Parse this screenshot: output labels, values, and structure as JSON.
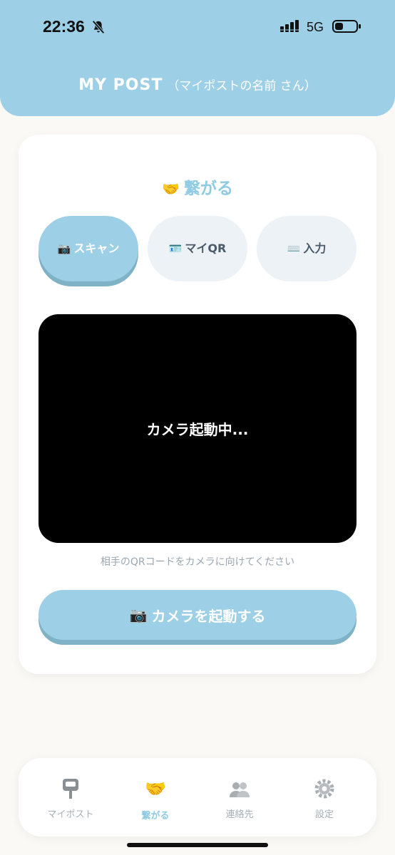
{
  "status_bar": {
    "time": "22:36",
    "network": "5G",
    "icons": [
      "bell-slash-icon",
      "signal-icon",
      "battery-icon"
    ]
  },
  "header": {
    "brand": "MY POST",
    "user": "（マイポストの名前 さん）",
    "color": "#9dcfe6"
  },
  "section": {
    "emoji": "🤝",
    "title": "繋がる"
  },
  "tabs": [
    {
      "emoji": "📷",
      "label": "スキャン",
      "active": true
    },
    {
      "emoji": "🪪",
      "label": "マイQR",
      "active": false
    },
    {
      "emoji": "⌨️",
      "label": "入力",
      "active": false
    }
  ],
  "camera": {
    "status": "カメラ起動中...",
    "hint": "相手のQRコードをカメラに向けてください"
  },
  "start_button": {
    "emoji": "📷",
    "label": "カメラを起動する"
  },
  "bottom_nav": {
    "items": [
      {
        "label": "マイポスト",
        "icon": "mailbox-icon",
        "active": false
      },
      {
        "label": "繋がる",
        "icon": "handshake-icon",
        "active": true
      },
      {
        "label": "連絡先",
        "icon": "people-icon",
        "active": false
      },
      {
        "label": "設定",
        "icon": "gear-icon",
        "active": false
      }
    ]
  },
  "colors": {
    "accent": "#9dcfe6",
    "accent_shadow": "#7fb2c4",
    "inactive_tab": "#edf2f6"
  }
}
